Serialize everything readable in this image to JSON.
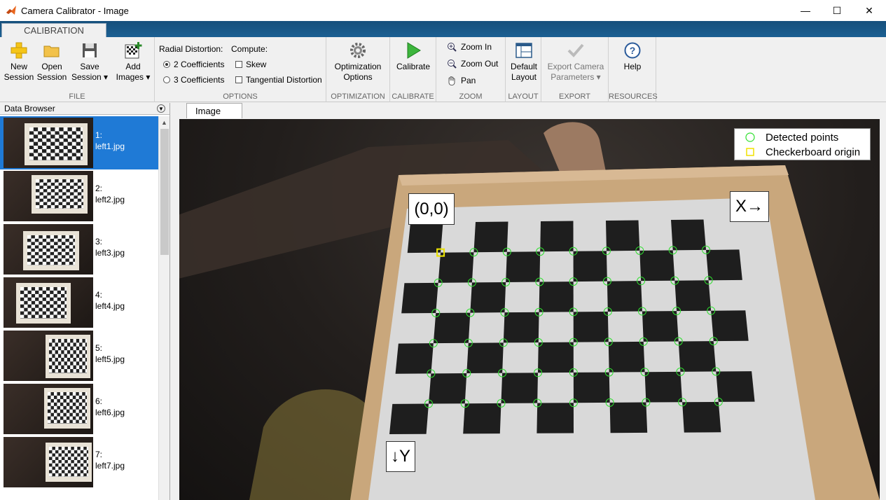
{
  "window": {
    "title": "Camera Calibrator - Image",
    "controls": [
      "—",
      "☐",
      "✕"
    ]
  },
  "ribbon": {
    "tab": "CALIBRATION",
    "file": {
      "new_session": "New\nSession",
      "open_session": "Open\nSession",
      "save_session": "Save\nSession ▾",
      "add_images": "Add\nImages ▾",
      "group_label": "FILE"
    },
    "options": {
      "radial_label": "Radial Distortion:",
      "compute_label": "Compute:",
      "coef2": "2 Coefficients",
      "coef3": "3 Coefficients",
      "skew": "Skew",
      "tangential": "Tangential Distortion",
      "group_label": "OPTIONS"
    },
    "optimization": {
      "button": "Optimization\nOptions",
      "group_label": "OPTIMIZATION"
    },
    "calibrate": {
      "button": "Calibrate",
      "group_label": "CALIBRATE"
    },
    "zoom": {
      "zoom_in": "Zoom In",
      "zoom_out": "Zoom Out",
      "pan": "Pan",
      "group_label": "ZOOM"
    },
    "layout": {
      "button": "Default\nLayout",
      "group_label": "LAYOUT"
    },
    "export": {
      "button": "Export Camera\nParameters ▾",
      "group_label": "EXPORT"
    },
    "resources": {
      "button": "Help",
      "group_label": "RESOURCES"
    }
  },
  "data_browser": {
    "title": "Data Browser",
    "items": [
      {
        "index": "1:",
        "name": "left1.jpg",
        "selected": true
      },
      {
        "index": "2:",
        "name": "left2.jpg",
        "selected": false
      },
      {
        "index": "3:",
        "name": "left3.jpg",
        "selected": false
      },
      {
        "index": "4:",
        "name": "left4.jpg",
        "selected": false
      },
      {
        "index": "5:",
        "name": "left5.jpg",
        "selected": false
      },
      {
        "index": "6:",
        "name": "left6.jpg",
        "selected": false
      },
      {
        "index": "7:",
        "name": "left7.jpg",
        "selected": false
      }
    ]
  },
  "image_panel": {
    "tab": "Image",
    "legend": {
      "detected": "Detected points",
      "origin": "Checkerboard origin"
    },
    "labels": {
      "origin": "(0,0)",
      "x_axis": "X→",
      "y_axis": "↓Y"
    },
    "colors": {
      "detected": "#2fe02f",
      "origin": "#f0e000"
    }
  }
}
